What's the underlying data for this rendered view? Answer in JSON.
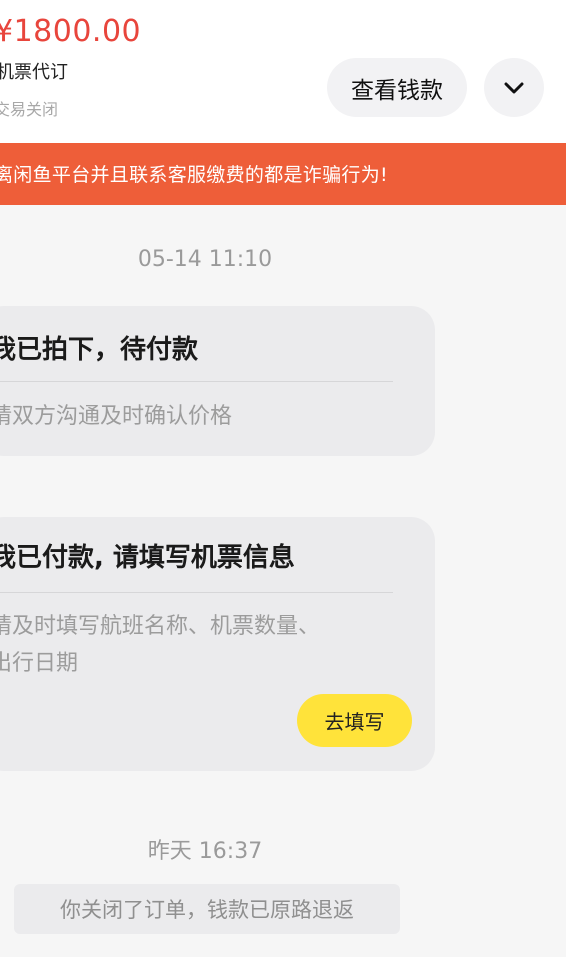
{
  "order": {
    "price": "¥1800.00",
    "title": "机票代订",
    "status": "交易关闭",
    "view_money_label": "查看钱款",
    "expand_icon": "chevron-down-icon"
  },
  "warning": {
    "text": "离闲鱼平台并且联系客服缴费的都是诈骗行为!"
  },
  "messages": [
    {
      "timestamp": "05-14 11:10",
      "title": "我已拍下，待付款",
      "desc_lines": [
        "请双方沟通及时确认价格"
      ]
    },
    {
      "title": "我已付款, 请填写机票信息",
      "desc_lines": [
        "请及时填写航班名称、机票数量、",
        "出行日期"
      ],
      "action_label": "去填写"
    }
  ],
  "closing": {
    "timestamp": "昨天 16:37",
    "notice": "你关闭了订单，钱款已原路退返"
  },
  "colors": {
    "price": "#e8453c",
    "warning_bg": "#ee5e39",
    "action_button": "#ffe33a"
  }
}
